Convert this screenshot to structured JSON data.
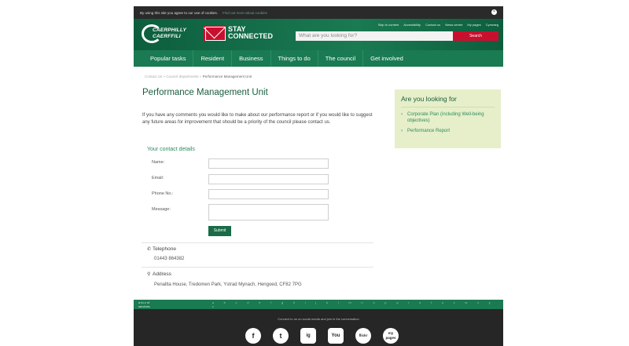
{
  "cookie": {
    "text": "By using this site you agree to our use of cookies.",
    "more": "Find out more about cookies",
    "close": "×"
  },
  "header": {
    "logo_line1": "CAERPHILLY",
    "logo_line2": "CAERFFILI",
    "stay_line1": "STAY",
    "stay_line2": "CONNECTED",
    "toplinks": [
      "Skip to content",
      "Accessibility",
      "Contact us",
      "News centre",
      "My pages",
      "Cymraeg"
    ],
    "search_placeholder": "What are you looking for?",
    "search_button": "Search"
  },
  "nav": [
    "Popular tasks",
    "Resident",
    "Business",
    "Things to do",
    "The council",
    "Get involved"
  ],
  "breadcrumb": {
    "a": "Contact Us",
    "b": "Council departments",
    "current": "Performance Management Unit",
    "sep": "»"
  },
  "page_title": "Performance Management Unit",
  "intro": "If you have any comments you would like to make about our performance report or if you would like to suggest any future areas for improvement that should be a priority of the council please contact us.",
  "form": {
    "heading": "Your contact details",
    "name_label": "Name:",
    "email_label": "Email:",
    "phone_label": "Phone No.:",
    "message_label": "Message:",
    "submit": "Submit"
  },
  "contact": {
    "telephone_label": "Telephone",
    "telephone_value": "01443 864382",
    "address_label": "Address",
    "address_value": "Penallta House, Tredomen Park, Ystrad Mynach, Hengoed, CF82 7PG"
  },
  "aside": {
    "heading": "Are you looking for",
    "links": [
      "Corporate Plan (including Well-being objectives)",
      "Performance Report"
    ]
  },
  "footer": {
    "az_label": "a to z of services",
    "az_letters": "a b c d e f g h i j k l m n o p q r s t u v w x y z",
    "connect_text": "Connect to us on social media and join in the conversation",
    "social": [
      "f",
      "t",
      "ig",
      "You",
      "flickr",
      "my pages"
    ]
  },
  "colors": {
    "primary_green": "#1a7a52",
    "accent_red": "#c8102e",
    "aside_bg": "#e6efc9"
  }
}
